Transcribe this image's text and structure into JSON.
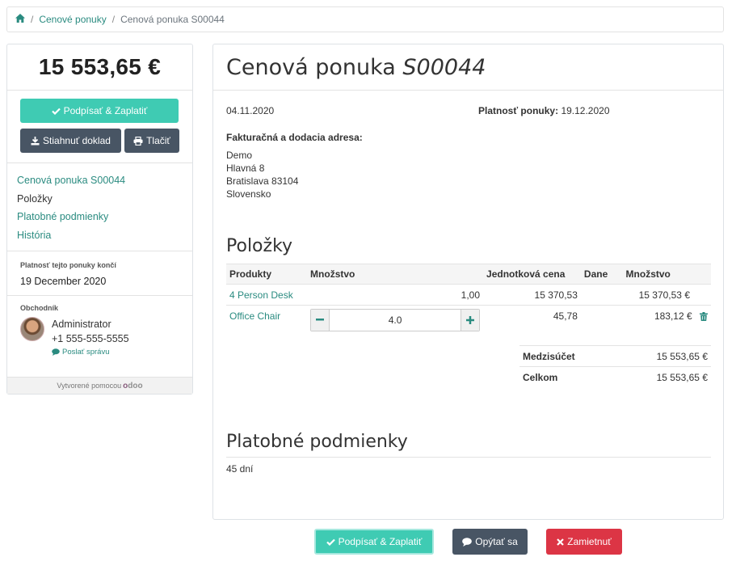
{
  "breadcrumb": {
    "home_icon": "home-icon",
    "items": [
      "Cenové ponuky",
      "Cenová ponuka S00044"
    ]
  },
  "sidebar": {
    "total": "15 553,65 €",
    "sign_pay_label": "Podpísať & Zaplatiť",
    "download_label": "Stiahnuť doklad",
    "print_label": "Tlačiť",
    "toc": [
      "Cenová ponuka S00044",
      "Položky",
      "Platobné podmienky",
      "História"
    ],
    "expiry_label": "Platnosť tejto ponuky končí",
    "expiry_date": "19 December 2020",
    "salesman_label": "Obchodník",
    "salesman_name": "Administrator",
    "salesman_phone": "+1 555-555-5555",
    "send_message_label": "Poslať správu",
    "powered_by": "Vytvorené pomocou",
    "logo_text": "odoo"
  },
  "quote": {
    "title_prefix": "Cenová ponuka",
    "title_number": "S00044",
    "date": "04.11.2020",
    "validity_label": "Platnosť ponuky:",
    "validity_date": "19.12.2020",
    "address_label": "Fakturačná a dodacia adresa:",
    "address": [
      "Demo",
      "Hlavná 8",
      "Bratislava 83104",
      "Slovensko"
    ]
  },
  "items_section": {
    "title": "Položky",
    "columns": [
      "Produkty",
      "Množstvo",
      "Jednotková cena",
      "Dane",
      "Množstvo"
    ],
    "rows": [
      {
        "product": "4 Person Desk",
        "quantity": "1,00",
        "unit_price": "15 370,53",
        "taxes": "",
        "amount": "15 370,53 €"
      },
      {
        "product": "Office Chair",
        "quantity": "4.0",
        "unit_price": "45,78",
        "taxes": "",
        "amount": "183,12 €"
      }
    ],
    "subtotal_label": "Medzisúčet",
    "subtotal": "15 553,65 €",
    "total_label": "Celkom",
    "total": "15 553,65 €"
  },
  "terms_section": {
    "title": "Platobné podmienky",
    "text": "45 dní"
  },
  "bottom_actions": {
    "sign_pay_label": "Podpísať & Zaplatiť",
    "ask_label": "Opýtať sa",
    "reject_label": "Zamietnuť"
  },
  "colors": {
    "primary": "#3fcbb3",
    "dark": "#485564",
    "danger": "#dc3545",
    "link": "#2a8b80"
  }
}
